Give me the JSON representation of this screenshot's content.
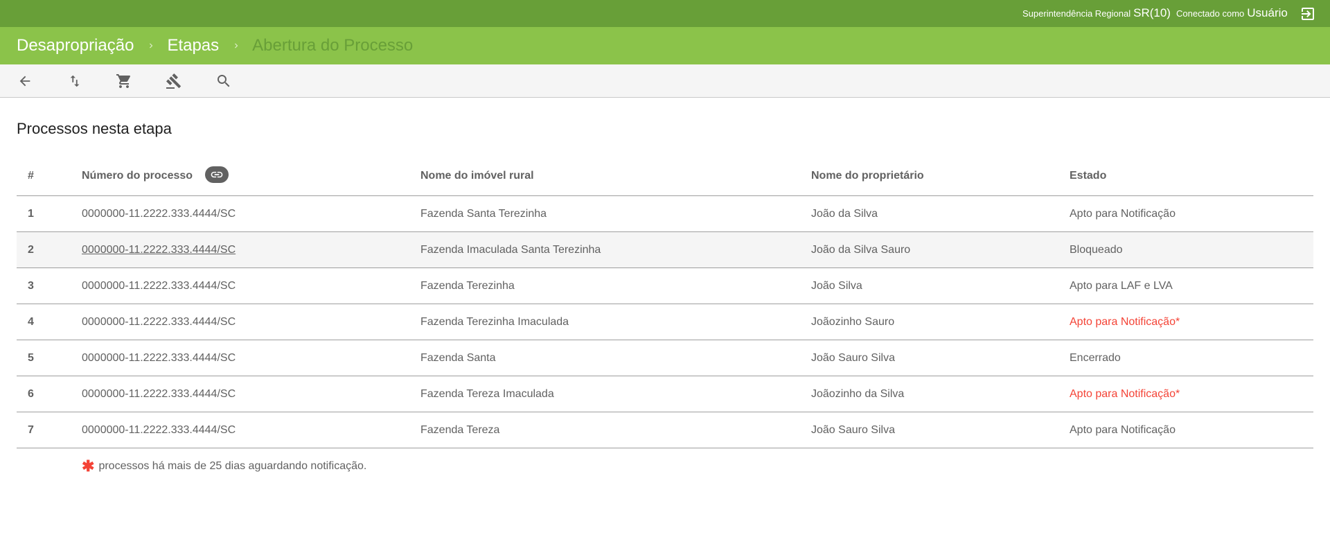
{
  "header": {
    "regional_label": "Superintendência Regional",
    "regional_value": "SR(10)",
    "user_label": "Conectado como",
    "user_value": "Usuário",
    "logout_icon": "logout-icon"
  },
  "breadcrumb": {
    "items": [
      "Desapropriação",
      "Etapas"
    ],
    "current": "Abertura do Processo"
  },
  "toolbar": {
    "icons": [
      "arrow-back-icon",
      "swap-vert-icon",
      "cart-icon",
      "gavel-icon",
      "search-icon"
    ]
  },
  "section_title": "Processos nesta etapa",
  "table": {
    "headers": [
      "#",
      "Número do processo",
      "Nome do imóvel rural",
      "Nome do proprietário",
      "Estado"
    ],
    "rows": [
      {
        "n": "1",
        "processo": "0000000-11.2222.333.4444/SC",
        "imovel": "Fazenda Santa Terezinha",
        "proprietario": "João da Silva",
        "estado": "Apto para Notificação"
      },
      {
        "n": "2",
        "processo": "0000000-11.2222.333.4444/SC",
        "imovel": "Fazenda Imaculada Santa Terezinha",
        "proprietario": "João da Silva Sauro",
        "estado": "Bloqueado"
      },
      {
        "n": "3",
        "processo": "0000000-11.2222.333.4444/SC",
        "imovel": "Fazenda Terezinha",
        "proprietario": "João Silva",
        "estado": "Apto para LAF e LVA"
      },
      {
        "n": "4",
        "processo": "0000000-11.2222.333.4444/SC",
        "imovel": "Fazenda Terezinha Imaculada",
        "proprietario": "Joãozinho Sauro",
        "estado": "Apto para Notificação*"
      },
      {
        "n": "5",
        "processo": "0000000-11.2222.333.4444/SC",
        "imovel": "Fazenda Santa",
        "proprietario": "João Sauro Silva",
        "estado": "Encerrado"
      },
      {
        "n": "6",
        "processo": "0000000-11.2222.333.4444/SC",
        "imovel": "Fazenda Tereza Imaculada",
        "proprietario": "Joãozinho da Silva",
        "estado": "Apto para Notificação*"
      },
      {
        "n": "7",
        "processo": "0000000-11.2222.333.4444/SC",
        "imovel": "Fazenda Tereza",
        "proprietario": "João Sauro Silva",
        "estado": "Apto para Notificação"
      }
    ]
  },
  "footnote": {
    "star": "✱",
    "text": "processos há mais de 25 dias aguardando notificação."
  },
  "colors": {
    "topbar": "#689f38",
    "breadcrumb_bar": "#8bc34a",
    "alert": "#f44336"
  }
}
